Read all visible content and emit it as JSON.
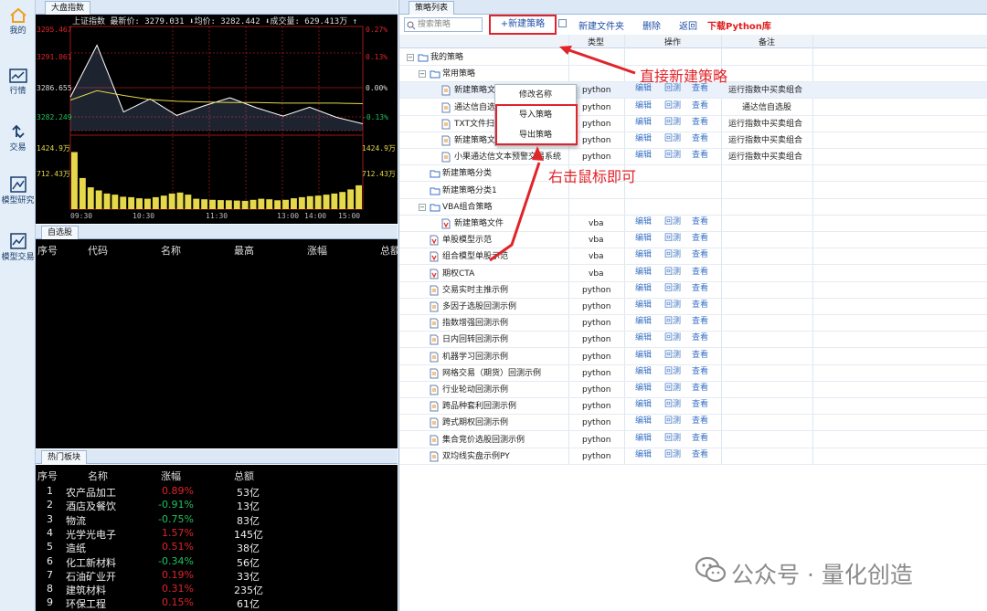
{
  "nav": [
    {
      "label": "我的",
      "icon": "home-icon"
    },
    {
      "label": "行情",
      "icon": "chart-icon"
    },
    {
      "label": "交易",
      "icon": "trade-icon"
    },
    {
      "label": "模型研究",
      "icon": "research-icon"
    },
    {
      "label": "模型交易",
      "icon": "model-trade-icon"
    }
  ],
  "market": {
    "tab": "大盘指数",
    "header": "上证指数  最新价: 3279.031 ⬇均价: 3282.442 ⬇成交量: 629.413万 ↑",
    "y_left": [
      "3295.467",
      "3291.061",
      "3286.655",
      "3282.249",
      "1424.9万",
      "712.43万"
    ],
    "y_right": [
      "0.27%",
      "0.13%",
      "0.00%",
      "-0.13%",
      "1424.9万",
      "712.43万"
    ],
    "x_labels": [
      "09:30",
      "10:30",
      "11:30",
      "13:00",
      "14:00",
      "15:00"
    ],
    "colors": {
      "up": "#e0242a",
      "down": "#21c25e",
      "neutral": "#dddddd",
      "price": "#ffffff",
      "avg": "#e5d84a",
      "volume": "#e5d84a"
    }
  },
  "chart_data": {
    "type": "line",
    "title": "上证指数",
    "x": [
      "09:30",
      "10:30",
      "11:30",
      "13:00",
      "14:00",
      "15:00"
    ],
    "ylim": [
      3277.84,
      3295.467
    ],
    "series": [
      {
        "name": "最新价",
        "values": [
          3283.5,
          3292.3,
          3281.0,
          3283.2,
          3280.4,
          3282.0,
          3283.4,
          3281.7,
          3280.3,
          3281.8,
          3280.1,
          3279.0
        ]
      },
      {
        "name": "均价",
        "values": [
          3283.0,
          3284.6,
          3283.8,
          3283.1,
          3282.8,
          3282.7,
          3282.6,
          3282.6,
          3282.5,
          3282.5,
          3282.5,
          3282.4
        ]
      }
    ],
    "volume_ylim": [
      0,
      1424.9
    ],
    "volume_values": [
      1100,
      600,
      420,
      360,
      300,
      280,
      240,
      230,
      210,
      200,
      230,
      260,
      300,
      320,
      280,
      200,
      190,
      180,
      175,
      170,
      165,
      160,
      180,
      200,
      190,
      170,
      180,
      210,
      230,
      250,
      260,
      280,
      300,
      330,
      380,
      460
    ]
  },
  "watchlist": {
    "tab": "自选股",
    "columns": [
      "序号",
      "代码",
      "名称",
      "最高",
      "涨幅",
      "总额"
    ]
  },
  "hot": {
    "tab": "热门板块",
    "columns": [
      "序号",
      "名称",
      "涨幅",
      "总额"
    ],
    "rows": [
      {
        "no": "1",
        "name": "农产品加工",
        "change": "0.89%",
        "amount": "53亿",
        "dir": "up"
      },
      {
        "no": "2",
        "name": "酒店及餐饮",
        "change": "-0.91%",
        "amount": "13亿",
        "dir": "down"
      },
      {
        "no": "3",
        "name": "物流",
        "change": "-0.75%",
        "amount": "83亿",
        "dir": "down"
      },
      {
        "no": "4",
        "name": "光学光电子",
        "change": "1.57%",
        "amount": "145亿",
        "dir": "up"
      },
      {
        "no": "5",
        "name": "造纸",
        "change": "0.51%",
        "amount": "38亿",
        "dir": "up"
      },
      {
        "no": "6",
        "name": "化工新材料",
        "change": "-0.34%",
        "amount": "56亿",
        "dir": "down"
      },
      {
        "no": "7",
        "name": "石油矿业开",
        "change": "0.19%",
        "amount": "33亿",
        "dir": "up"
      },
      {
        "no": "8",
        "name": "建筑材料",
        "change": "0.31%",
        "amount": "235亿",
        "dir": "up"
      },
      {
        "no": "9",
        "name": "环保工程",
        "change": "0.15%",
        "amount": "61亿",
        "dir": "up"
      }
    ]
  },
  "strategy": {
    "tab": "策略列表",
    "search_placeholder": "搜索策略",
    "toolbar": {
      "new": "+新建策略",
      "new_folder": "新建文件夹",
      "delete": "删除",
      "back": "返回",
      "download": "下载Python库"
    },
    "columns": [
      "类型",
      "操作",
      "备注"
    ],
    "actions": {
      "edit": "编辑",
      "backtest": "回测",
      "view": "查看"
    },
    "rows": [
      {
        "kind": "folder",
        "level": 0,
        "name": "我的策略",
        "toggle": "⊟"
      },
      {
        "kind": "folder",
        "level": 1,
        "name": "常用策略",
        "toggle": "⊟"
      },
      {
        "kind": "file",
        "level": 2,
        "name": "新建策略文",
        "type": "python",
        "ops": true,
        "note": "运行指数中买卖组合",
        "selected": true
      },
      {
        "kind": "file",
        "level": 2,
        "name": "通达信自选",
        "type": "python",
        "ops": true,
        "note": "通达信自选股"
      },
      {
        "kind": "file",
        "level": 2,
        "name": "TXT文件扫",
        "type": "python",
        "ops": true,
        "note": "运行指数中买卖组合"
      },
      {
        "kind": "file",
        "level": 2,
        "name": "新建策略文",
        "type": "python",
        "ops": true,
        "note": "运行指数中买卖组合"
      },
      {
        "kind": "file",
        "level": 2,
        "name": "小果通达信文本预警交易系统",
        "type": "python",
        "ops": true,
        "note": "运行指数中买卖组合"
      },
      {
        "kind": "folder",
        "level": 1,
        "name": "新建策略分类"
      },
      {
        "kind": "folder",
        "level": 1,
        "name": "新建策略分类1"
      },
      {
        "kind": "folder",
        "level": 1,
        "name": "VBA组合策略",
        "toggle": "⊟"
      },
      {
        "kind": "vfile",
        "level": 2,
        "name": "新建策略文件",
        "type": "vba",
        "ops": true,
        "note": ""
      },
      {
        "kind": "vfile",
        "level": 1,
        "name": "单股模型示范",
        "type": "vba",
        "ops": true,
        "note": ""
      },
      {
        "kind": "vfile",
        "level": 1,
        "name": "组合模型单股示范",
        "type": "vba",
        "ops": true,
        "note": ""
      },
      {
        "kind": "vfile",
        "level": 1,
        "name": "期权CTA",
        "type": "vba",
        "ops": true,
        "note": ""
      },
      {
        "kind": "file",
        "level": 1,
        "name": "交易实时主推示例",
        "type": "python",
        "ops": true,
        "note": ""
      },
      {
        "kind": "file",
        "level": 1,
        "name": "多因子选股回测示例",
        "type": "python",
        "ops": true,
        "note": ""
      },
      {
        "kind": "file",
        "level": 1,
        "name": "指数增强回测示例",
        "type": "python",
        "ops": true,
        "note": ""
      },
      {
        "kind": "file",
        "level": 1,
        "name": "日内回转回测示例",
        "type": "python",
        "ops": true,
        "note": ""
      },
      {
        "kind": "file",
        "level": 1,
        "name": "机器学习回测示例",
        "type": "python",
        "ops": true,
        "note": ""
      },
      {
        "kind": "file",
        "level": 1,
        "name": "网格交易（期货）回测示例",
        "type": "python",
        "ops": true,
        "note": ""
      },
      {
        "kind": "file",
        "level": 1,
        "name": "行业轮动回测示例",
        "type": "python",
        "ops": true,
        "note": ""
      },
      {
        "kind": "file",
        "level": 1,
        "name": "跨品种套利回测示例",
        "type": "python",
        "ops": true,
        "note": ""
      },
      {
        "kind": "file",
        "level": 1,
        "name": "跨式期权回测示例",
        "type": "python",
        "ops": true,
        "note": ""
      },
      {
        "kind": "file",
        "level": 1,
        "name": "集合竞价选股回测示例",
        "type": "python",
        "ops": true,
        "note": ""
      },
      {
        "kind": "file",
        "level": 1,
        "name": "双均线实盘示例PY",
        "type": "python",
        "ops": true,
        "note": ""
      }
    ]
  },
  "context_menu": {
    "rename": "修改名称",
    "import": "导入策略",
    "export": "导出策略"
  },
  "annotations": {
    "new_strategy": "直接新建策略",
    "right_click": "右击鼠标即可"
  },
  "watermark": {
    "text": "公众号 · 量化创造",
    "icon": "wechat-icon"
  }
}
